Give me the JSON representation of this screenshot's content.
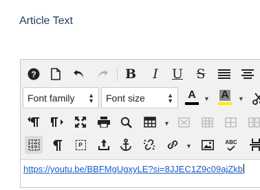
{
  "field": {
    "label": "Article Text"
  },
  "toolbar": {
    "row1": {
      "help_icon": "question-circle-icon",
      "new_document_icon": "new-document-icon",
      "undo_icon": "undo-icon",
      "redo_icon": "redo-icon",
      "bold_label": "B",
      "italic_label": "I",
      "underline_label": "U",
      "strikethrough_label": "S",
      "justify_icon": "justify-icon",
      "align_center_icon": "align-center-icon"
    },
    "row2": {
      "font_family": {
        "value": "Font family"
      },
      "font_size": {
        "value": "Font size"
      },
      "text_color": {
        "label": "A",
        "color": "#000000"
      },
      "background_color": {
        "label": "A",
        "color": "#f1f100"
      },
      "cut_icon": "scissors-icon"
    },
    "row3": {
      "ltr_icon": "paragraph-ltr-icon",
      "rtl_icon": "paragraph-rtl-icon",
      "fullscreen_icon": "fullscreen-icon",
      "print_icon": "print-icon",
      "search_icon": "search-icon",
      "table_icon": "table-icon"
    },
    "row4": {
      "visual_aid_icon": "visual-aid-icon",
      "show_blocks_icon": "pilcrow-icon",
      "paragraph_block_label": "P",
      "insert_icon": "insert-icon",
      "anchor_icon": "anchor-icon",
      "unlink_icon": "unlink-icon",
      "link_icon": "link-icon",
      "image_icon": "image-icon",
      "spellcheck_label": "ABC"
    }
  },
  "content": {
    "link_text": "https://youtu.be/BBFMgUgxyLE?si=8JJEC1Z9c09ajZkb"
  }
}
